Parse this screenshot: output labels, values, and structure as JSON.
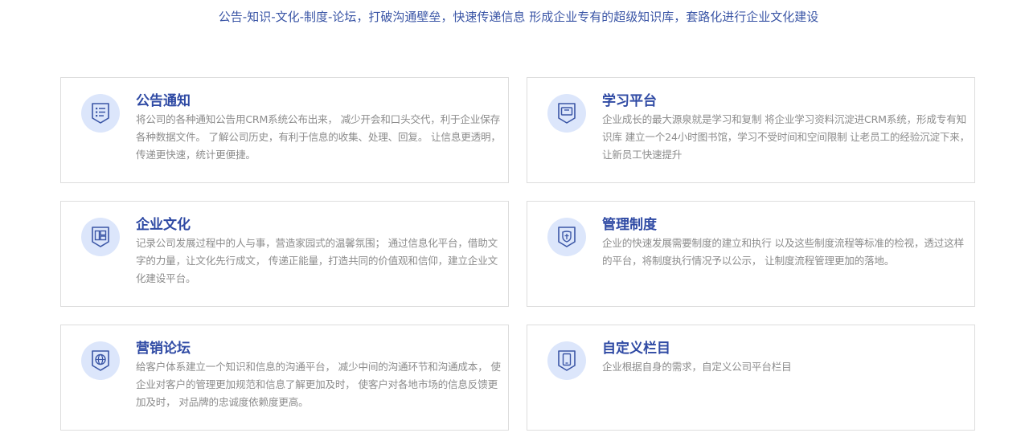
{
  "header": {
    "subtitle": "公告-知识-文化-制度-论坛，打破沟通壁垒，快速传递信息 形成企业专有的超级知识库，套路化进行企业文化建设"
  },
  "accent_color": "#2f4aa4",
  "icon_bg_color": "#dce6fb",
  "cards": [
    {
      "icon": "list-icon",
      "title": "公告通知",
      "description": "将公司的各种通知公告用CRM系统公布出来， 减少开会和口头交代，利于企业保存各种数据文件。 了解公司历史，有利于信息的收集、处理、回复。 让信息更透明，传递更快速，统计更便捷。"
    },
    {
      "icon": "monitor-icon",
      "title": "学习平台",
      "description": "企业成长的最大源泉就是学习和复制 将企业学习资料沉淀进CRM系统，形成专有知识库 建立一个24小时图书馆，学习不受时间和空间限制 让老员工的经验沉淀下来，让新员工快速提升"
    },
    {
      "icon": "layout-icon",
      "title": "企业文化",
      "description": "记录公司发展过程中的人与事，营造家园式的温馨氛围； 通过信息化平台，借助文字的力量，让文化先行成文， 传递正能量，打造共同的价值观和信仰，建立企业文化建设平台。"
    },
    {
      "icon": "shield-icon",
      "title": "管理制度",
      "description": "企业的快速发展需要制度的建立和执行 以及这些制度流程等标准的检视，透过这样的平台，将制度执行情况予以公示， 让制度流程管理更加的落地。"
    },
    {
      "icon": "globe-icon",
      "title": "营销论坛",
      "description": "给客户体系建立一个知识和信息的沟通平台， 减少中间的沟通环节和沟通成本， 使企业对客户的管理更加规范和信息了解更加及时， 使客户对各地市场的信息反馈更加及时， 对品牌的忠诚度依赖度更高。"
    },
    {
      "icon": "tablet-icon",
      "title": "自定义栏目",
      "description": "企业根据自身的需求，自定义公司平台栏目"
    }
  ]
}
